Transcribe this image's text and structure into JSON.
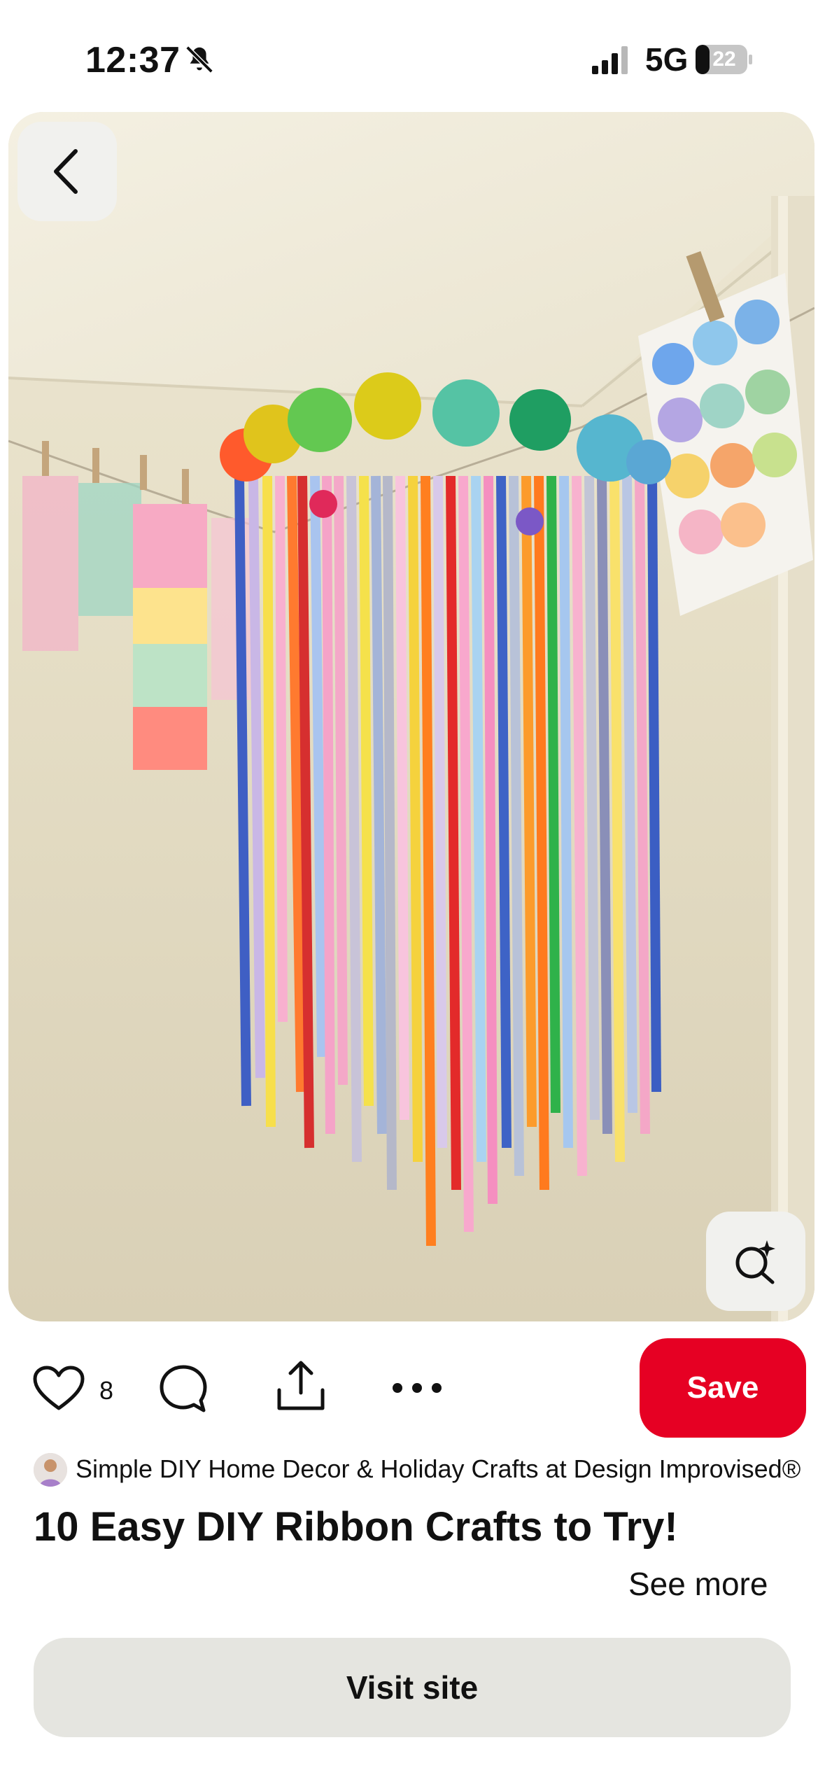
{
  "status_bar": {
    "time": "12:37",
    "network": "5G",
    "battery": "22",
    "icons": [
      "bell-slash-icon",
      "signal-icon",
      "battery-icon"
    ]
  },
  "pin": {
    "image_icon": "ribbon-chandelier-photo",
    "back_icon": "chevron-left-icon",
    "lens_icon": "visual-search-icon"
  },
  "actions": {
    "like_count": "8",
    "like_icon": "heart-icon",
    "comment_icon": "comment-icon",
    "share_icon": "share-icon",
    "more_icon": "more-icon",
    "save_label": "Save"
  },
  "creator": {
    "name": "Simple DIY Home Decor & Holiday Crafts at Design Improvised®"
  },
  "title": "10 Easy DIY Ribbon Crafts to Try!",
  "see_more": "See more",
  "visit_site": "Visit site",
  "colors": {
    "save": "#e60023",
    "visit_bg": "#e5e5e0",
    "button_bg": "#f1f1ee",
    "text": "#111111"
  }
}
